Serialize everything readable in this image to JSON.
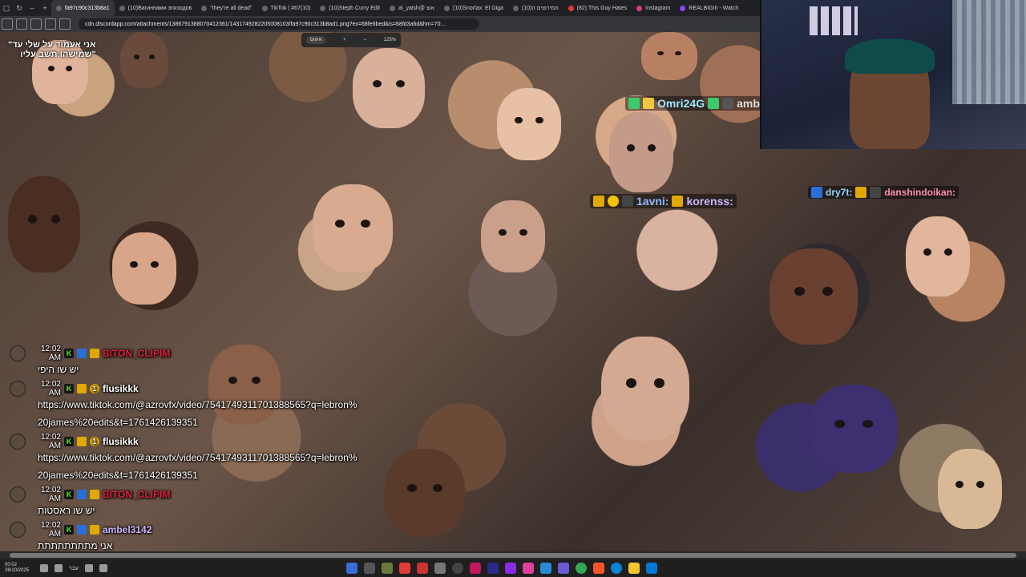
{
  "tabs": [
    {
      "label": "fa97c90c313b8a1",
      "active": true
    },
    {
      "label": "(10)Вагиннами эпизодов",
      "active": false
    },
    {
      "label": "\"they're all dead\"",
      "active": false
    },
    {
      "label": "TikTok | #67(10)",
      "active": false
    },
    {
      "label": "(10)Steph Curry Edit",
      "active": false
    },
    {
      "label": "al_yaish@ אוצ",
      "active": false
    },
    {
      "label": "(10)Snorlax: El Giga",
      "active": false
    },
    {
      "label": "(10)המירוצים ה",
      "active": false
    },
    {
      "label": "(82) This Guy Hates",
      "active": false
    },
    {
      "label": "Instagram",
      "active": false
    },
    {
      "label": "REALBIGIII - Watch",
      "active": false
    }
  ],
  "address": {
    "url": "cdn.discordapp.com/attachments/1386791388070412361/1431749282205008103/fa97c90c313b8ad1.png?ex=68fe6bed&is=68fd3a6d&hm=70..."
  },
  "zoom": {
    "reset_label": "איפוס",
    "plus": "+",
    "minus": "−",
    "level": "125%"
  },
  "overlay_caption": {
    "line1": "אני אעמוד על שלי עד\"",
    "line2": "\"שמישהו תשב עליו"
  },
  "emote_labels": {
    "omri": "Omri24G",
    "amb": "amb",
    "lavni": "1avni:",
    "koren": "korenss:",
    "dry": "dry7t:",
    "dansh": "danshindoikan:"
  },
  "chat": [
    {
      "time": "12:02 AM",
      "user": "BITON_CLIPIM",
      "color": "#e0203a",
      "text": "יש שו היפי",
      "rtl": true
    },
    {
      "time": "12:02 AM",
      "user": "flusikkk",
      "color": "#ffffff",
      "text": "https://www.tiktok.com/@azrovfx/video/7541749311701388565?q=lebron%20james%20edits&t=1761426139351",
      "rtl": false
    },
    {
      "time": "12:02 AM",
      "user": "flusikkk",
      "color": "#ffffff",
      "text": "https://www.tiktok.com/@azrovfx/video/7541749311701388565?q=lebron%20james%20edits&t=1761426139351",
      "rtl": false
    },
    {
      "time": "12:02 AM",
      "user": "BITON_CLIPIM",
      "color": "#e0203a",
      "text": "יש שו ראסטות",
      "rtl": true
    },
    {
      "time": "12:02 AM",
      "user": "ambel3142",
      "color": "#cfb7ff",
      "text": "אני מתתתתתתתת",
      "rtl": true
    }
  ],
  "taskbar": {
    "time": "00:02",
    "date": "26/10/2025",
    "lang": "עבר"
  },
  "icons": {
    "back": "back-arrow-icon",
    "forward": "forward-arrow-icon",
    "reload": "reload-icon",
    "badge_k": "K",
    "badge_one": "1"
  }
}
